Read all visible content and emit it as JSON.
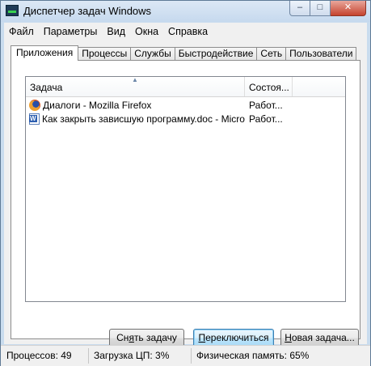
{
  "window": {
    "title": "Диспетчер задач Windows",
    "controls": {
      "minimize": "–",
      "maximize": "□",
      "close": "✕"
    }
  },
  "menu": [
    "Файл",
    "Параметры",
    "Вид",
    "Окна",
    "Справка"
  ],
  "tabs": [
    {
      "label": "Приложения",
      "active": true
    },
    {
      "label": "Процессы"
    },
    {
      "label": "Службы"
    },
    {
      "label": "Быстродействие"
    },
    {
      "label": "Сеть"
    },
    {
      "label": "Пользователи"
    }
  ],
  "table": {
    "columns": [
      "Задача",
      "Состоя..."
    ],
    "rows": [
      {
        "icon": "firefox-icon",
        "task": "Диалоги - Mozilla Firefox",
        "status": "Работ..."
      },
      {
        "icon": "word-document-icon",
        "task": "Как закрыть зависшую программу.doc - Micro...",
        "status": "Работ..."
      }
    ]
  },
  "buttons": {
    "end_task": {
      "pre": "Сн",
      "key": "я",
      "post": "ть задачу"
    },
    "switch": {
      "pre": "",
      "key": "П",
      "post": "ереключиться"
    },
    "new_task": {
      "pre": "",
      "key": "Н",
      "post": "овая задача..."
    }
  },
  "status": {
    "processes": "Процессов: 49",
    "cpu": "Загрузка ЦП: 3%",
    "memory": "Физическая память: 65%"
  },
  "colors": {
    "frame": "#c9dcee",
    "switch_button": "#bee6fd"
  }
}
